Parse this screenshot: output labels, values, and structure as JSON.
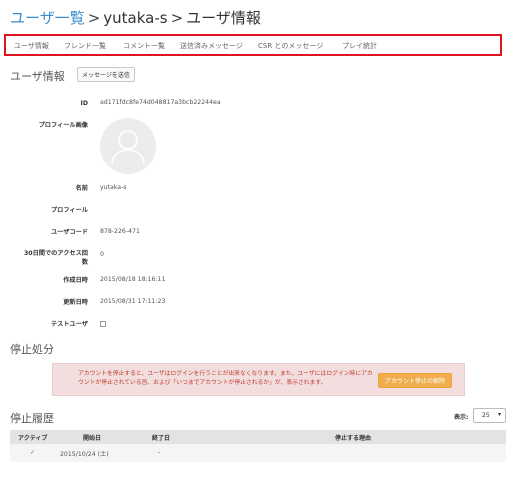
{
  "breadcrumb": {
    "root": "ユーザ一覧",
    "separator": ">",
    "user": "yutaka-s",
    "current": "ユーザ情報"
  },
  "tabs": [
    {
      "label": "ユーザ情報"
    },
    {
      "label": "フレンド一覧"
    },
    {
      "label": "コメント一覧"
    },
    {
      "label": "送信済みメッセージ"
    },
    {
      "label": "CSR とのメッセージ"
    },
    {
      "label": "プレイ統計"
    }
  ],
  "user_section": {
    "title": "ユーザ情報",
    "send_message_button": "メッセージを送信"
  },
  "fields": {
    "id": {
      "label": "ID",
      "value": "ad171fdc8fe74d048817a3bcb22244ea"
    },
    "profile_image": {
      "label": "プロフィール画像"
    },
    "name": {
      "label": "名前",
      "value": "yutaka-s"
    },
    "profile": {
      "label": "プロフィール",
      "value": ""
    },
    "user_code": {
      "label": "ユーザコード",
      "value": "878-226-471"
    },
    "access_count": {
      "label": "30日間でのアクセス回数",
      "value": "0"
    },
    "created_at": {
      "label": "作成日時",
      "value": "2015/08/18 18:16:11"
    },
    "updated_at": {
      "label": "更新日時",
      "value": "2015/08/31 17:11:23"
    },
    "test_user": {
      "label": "テストユーザ",
      "checked": false
    }
  },
  "suspension": {
    "title": "停止処分",
    "alert_text": "アカウントを停止すると、ユーザはログインを行うことが出来なくなります。また、ユーザにはログイン時にアカウントが停止されている旨、および「いつまでアカウントが停止されるか」が、表示されます。",
    "unsuspend_button": "アカウント停止の解除"
  },
  "history": {
    "title": "停止履歴",
    "show_label": "表示:",
    "page_size": "25",
    "caret": "▾",
    "columns": [
      "アクティブ",
      "開始日",
      "終了日",
      "停止する理由"
    ],
    "rows": [
      {
        "active": "✓",
        "start": "2015/10/24 (土)",
        "end": "-",
        "reason": ""
      }
    ]
  },
  "colors": {
    "link": "#3a8cd0",
    "highlight_border": "#e0141e",
    "alert_bg": "#f2dede",
    "alert_text": "#c0392b",
    "warning_button": "#f0ad4e"
  }
}
